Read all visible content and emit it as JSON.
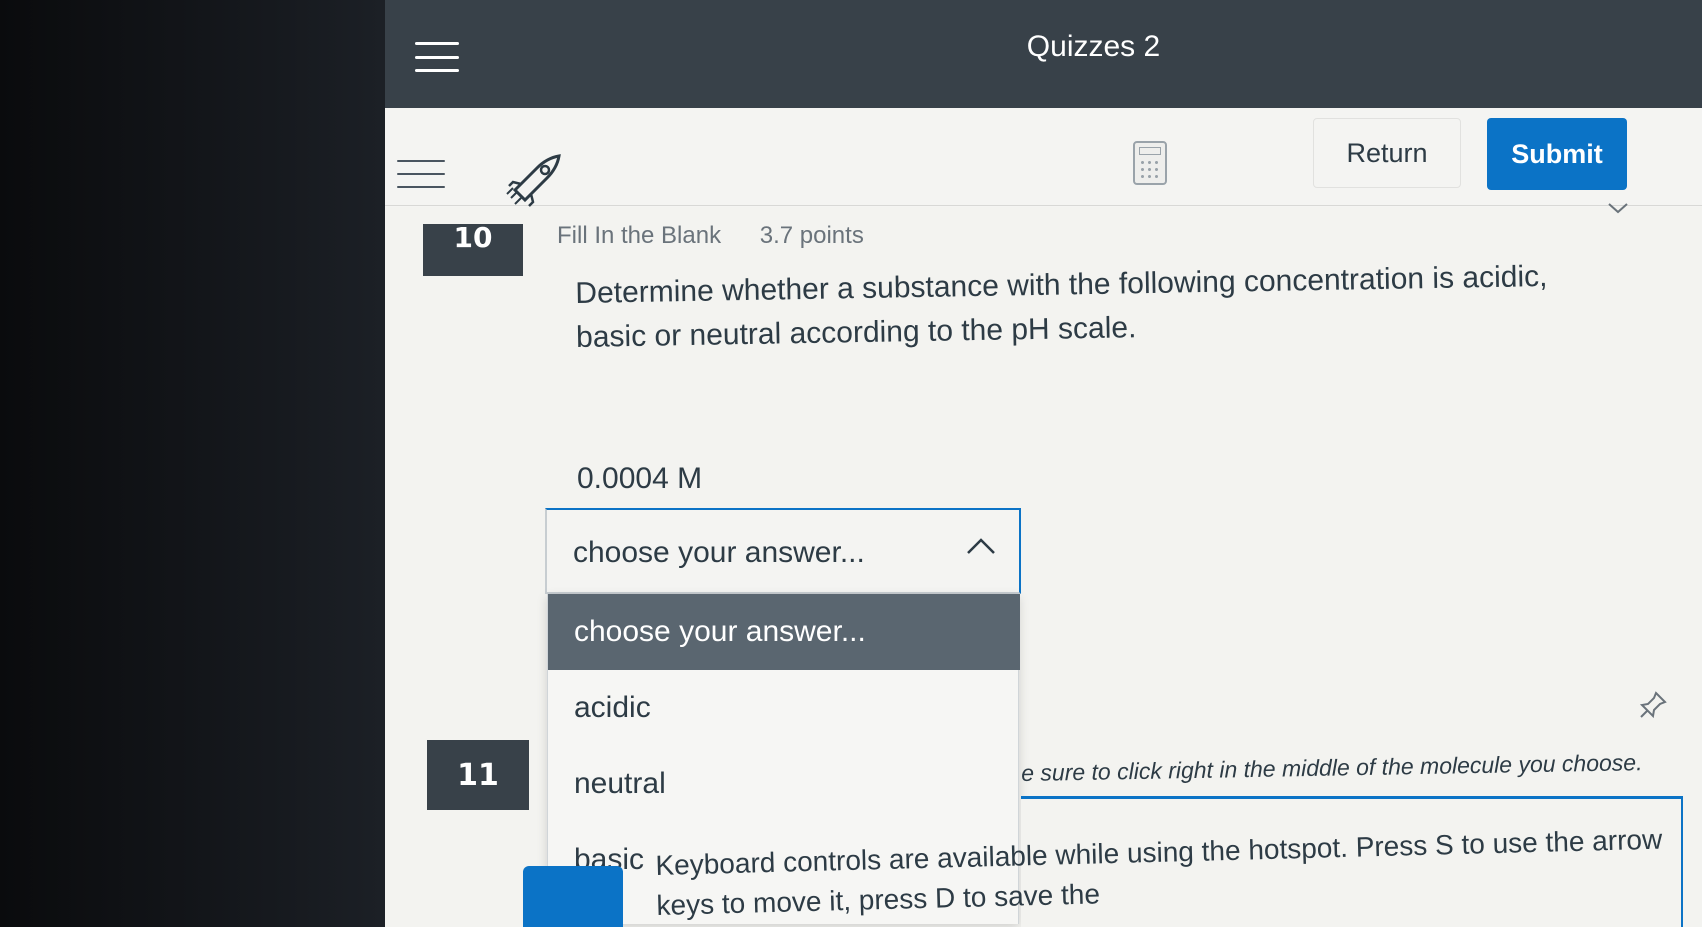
{
  "app": {
    "title": "Quizzes 2"
  },
  "toolbar": {
    "return_label": "Return",
    "submit_label": "Submit"
  },
  "question10": {
    "number": "10",
    "type": "Fill In the Blank",
    "points": "3.7 points",
    "text": "Determine whether a substance with the following concentration is acidic, basic or neutral according to the pH scale.",
    "concentration": "0.0004 M",
    "select": {
      "value": "choose your answer...",
      "options": [
        "choose your answer...",
        "acidic",
        "neutral",
        "basic"
      ]
    }
  },
  "question11": {
    "number": "11",
    "instruction": "e sure to click right in the middle of the molecule you choose.",
    "hotspot_text": "Keyboard controls are available while using the hotspot. Press S to use the arrow keys to move it, press D to save the"
  },
  "colors": {
    "appbar": "#384149",
    "accent": "#0b73c6",
    "selected_option": "#5a6670"
  }
}
